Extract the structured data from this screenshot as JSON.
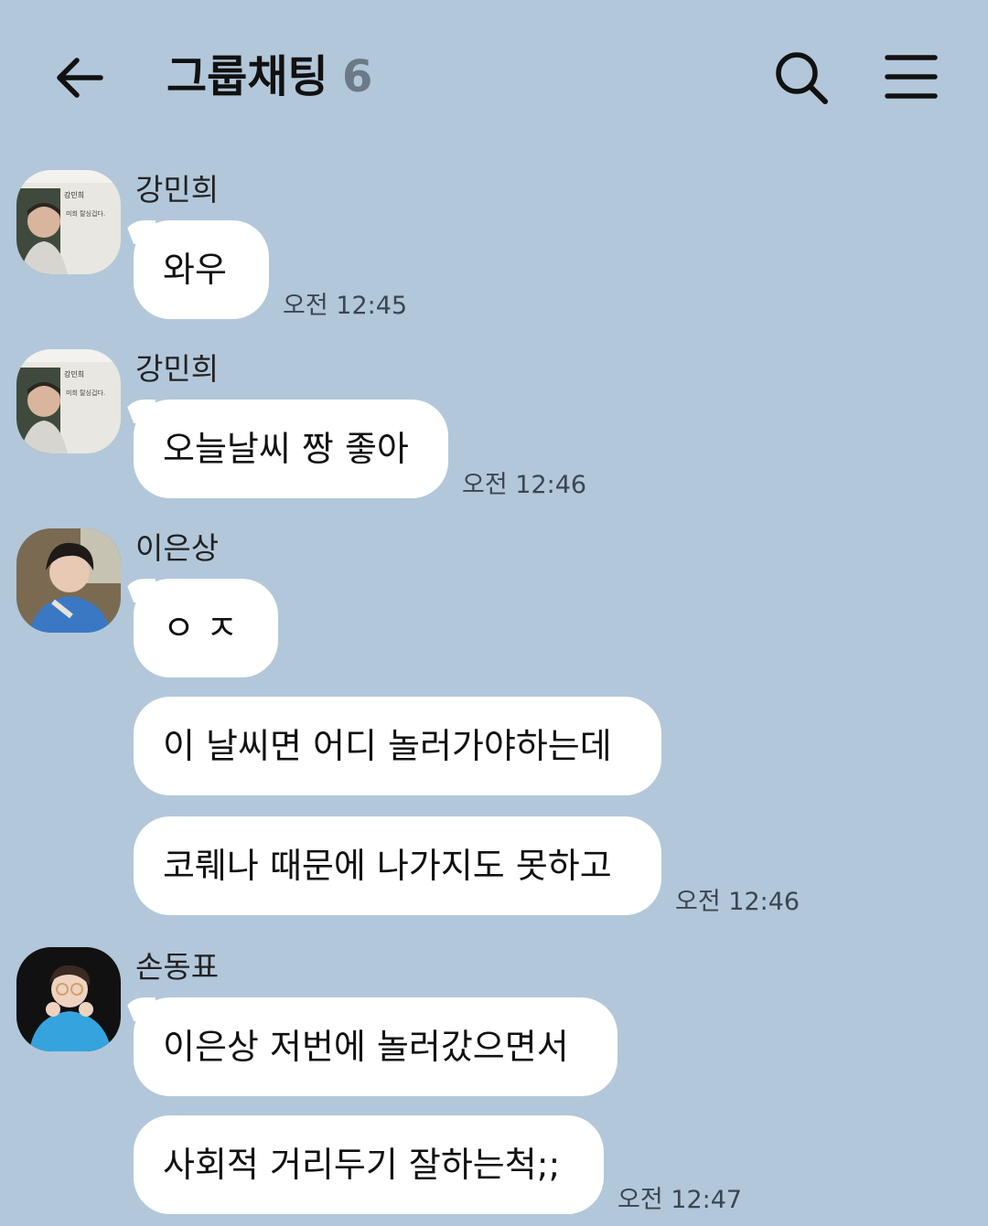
{
  "header": {
    "title": "그룹채팅",
    "member_count": "6"
  },
  "messages": [
    {
      "sender": "강민희",
      "bubbles": [
        "와우"
      ],
      "time": "오전 12:45"
    },
    {
      "sender": "강민희",
      "bubbles": [
        "오늘날씨 짱 좋아"
      ],
      "time": "오전 12:46"
    },
    {
      "sender": "이은상",
      "bubbles": [
        "ㅇ ㅈ",
        "이 날씨면 어디 놀러가야하는데",
        "코뤠나 때문에 나가지도 못하고"
      ],
      "time": "오전 12:46"
    },
    {
      "sender": "손동표",
      "bubbles": [
        "이은상 저번에 놀러갔으면서",
        "사회적 거리두기 잘하는척;;"
      ],
      "time": "오전 12:47"
    }
  ],
  "avatar_images": {
    "minhee_photo_caption_name": "강민희",
    "minhee_photo_caption_text": "미희 탈싱겁다."
  },
  "colors": {
    "background": "#b2c7da",
    "bubble": "#ffffff",
    "member_count": "#6b7a86"
  },
  "icons": [
    "back-arrow-icon",
    "search-icon",
    "menu-icon"
  ]
}
